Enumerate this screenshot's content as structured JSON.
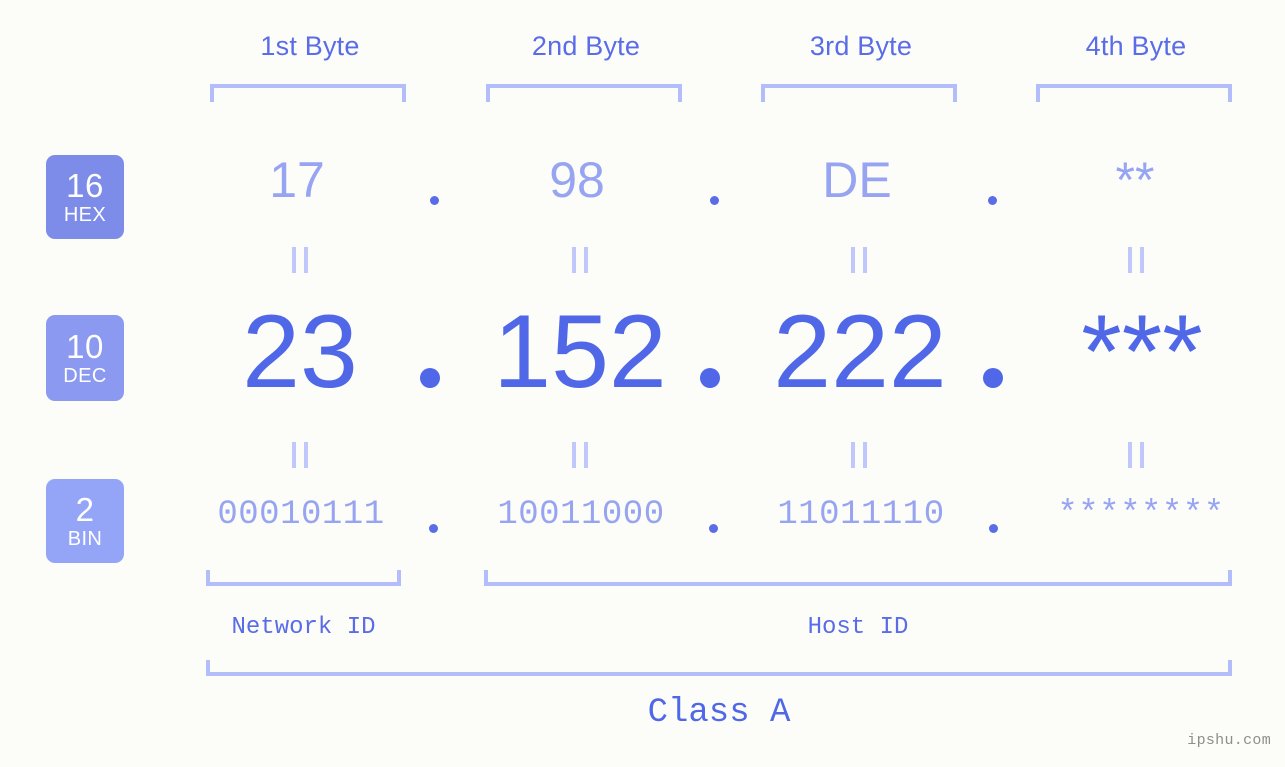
{
  "background_color": "#fcfdf8",
  "accent_colors": {
    "primary_blue": "#5068e8",
    "label_blue": "#5a6ce8",
    "light_blue": "#97a4f2",
    "bracket_blue": "#b3bdfa",
    "equals_blue": "#c0c8fb",
    "badge_hex": "#7d8ce8",
    "badge_dec": "#8b99f0",
    "badge_bin": "#94a5f7",
    "watermark_gray": "#8e8e8e"
  },
  "byte_headers": [
    {
      "label": "1st Byte"
    },
    {
      "label": "2nd Byte"
    },
    {
      "label": "3rd Byte"
    },
    {
      "label": "4th Byte"
    }
  ],
  "bases": [
    {
      "number": "16",
      "name": "HEX"
    },
    {
      "number": "10",
      "name": "DEC"
    },
    {
      "number": "2",
      "name": "BIN"
    }
  ],
  "rows": {
    "hex": {
      "base_number": "16",
      "base_name": "HEX",
      "values": [
        "17",
        "98",
        "DE",
        "**"
      ],
      "separator": "."
    },
    "dec": {
      "base_number": "10",
      "base_name": "DEC",
      "values": [
        "23",
        "152",
        "222",
        "***"
      ],
      "separator": "."
    },
    "bin": {
      "base_number": "2",
      "base_name": "BIN",
      "values": [
        "00010111",
        "10011000",
        "11011110",
        "********"
      ],
      "separator": "."
    }
  },
  "equals_marks": {
    "glyph": "=",
    "count_per_row": 4,
    "rows": 2
  },
  "segments": {
    "network_id": "Network ID",
    "host_id": "Host ID",
    "class": "Class A"
  },
  "watermark": "ipshu.com"
}
